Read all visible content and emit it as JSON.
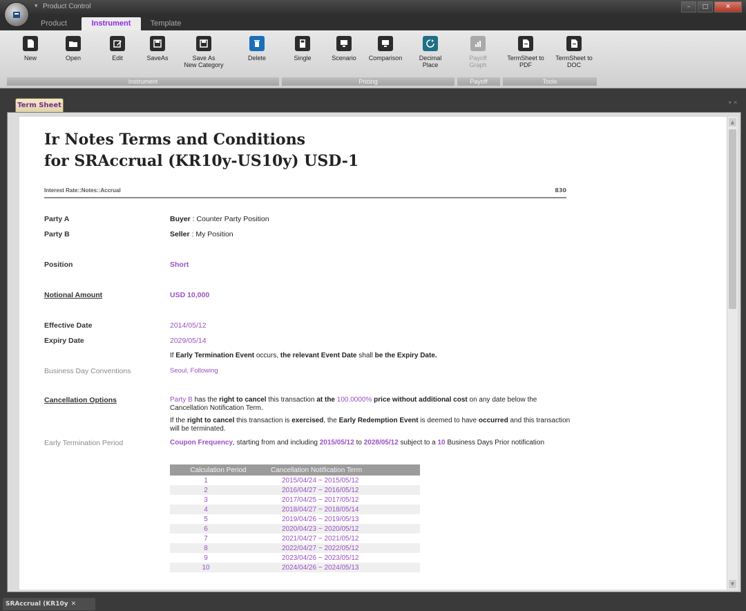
{
  "app": {
    "title": "Product Control"
  },
  "tabs": [
    "Product",
    "Instrument",
    "Template"
  ],
  "ribbon": {
    "buttons": [
      {
        "label": "New"
      },
      {
        "label": "Open"
      },
      {
        "label": "Edit"
      },
      {
        "label": "SaveAs"
      },
      {
        "label": "Save As\nNew Category"
      },
      {
        "label": "Delete"
      },
      {
        "label": "Single"
      },
      {
        "label": "Scenario"
      },
      {
        "label": "Comparison"
      },
      {
        "label": "Decimal\nPlace"
      },
      {
        "label": "Payoff\nGraph"
      },
      {
        "label": "TermSheet to\nPDF"
      },
      {
        "label": "TermSheet to\nDOC"
      }
    ],
    "groups": [
      "Instrument",
      "Pricing",
      "Payoff",
      "Tools"
    ]
  },
  "doc_tab": "Term Sheet",
  "term_sheet": {
    "title_line1": "Ir Notes Terms and Conditions",
    "title_line2": "for SRAccrual (KR10y-US10y) USD-1",
    "category": "Interest Rate::Notes::Accrual",
    "code": "830",
    "party_a_label": "Party A",
    "party_a_role": "Buyer",
    "party_a_value": " : Counter Party Position",
    "party_b_label": "Party B",
    "party_b_role": "Seller",
    "party_b_value": " : My Position",
    "position_label": "Position",
    "position_value": "Short",
    "notional_label": "Notional Amount",
    "notional_value": "USD 10,000",
    "effective_label": "Effective Date",
    "effective_value": "2014/05/12",
    "expiry_label": "Expiry Date",
    "expiry_value": "2029/05/14",
    "early_term_prefix": "If ",
    "early_term_event": "Early Termination Event",
    "early_term_mid": " occurs, ",
    "early_term_bold": "the relevant Event Date",
    "early_term_shall": " shall ",
    "early_term_end": "be the Expiry Date.",
    "bdc_label": "Business Day Conventions",
    "bdc_value": "Seoul, Following",
    "cancel_label": "Cancellation Options",
    "cancel_party": "Party B",
    "cancel_has": " has the ",
    "cancel_right": "right to cancel",
    "cancel_txn": " this transaction ",
    "cancel_at": "at the ",
    "cancel_pct": "100.0000%",
    "cancel_price": " price without additional cost",
    "cancel_rest": " on any date below the Cancellation Notification Term.",
    "exercise_if": "If the ",
    "exercise_right": "right to cancel",
    "exercise_is": " this transaction is ",
    "exercise_exercised": "exercised",
    "exercise_the": ", the ",
    "exercise_ere": "Early Redemption Event",
    "exercise_deemed": " is deemed to have ",
    "exercise_occurred": "occurred",
    "exercise_end": " and this transaction will be terminated.",
    "etp_label": "Early Termination Period",
    "etp_freq": "Coupon Frequency",
    "etp_start": ", starting from and including ",
    "etp_from": "2015/05/12",
    "etp_to_word": " to ",
    "etp_to": "2028/05/12",
    "etp_subject": " subject to a ",
    "etp_days": "10",
    "etp_end": " Business Days Prior notification",
    "table_headers": [
      "Calculation Period",
      "Cancellation Notification Term"
    ],
    "table_rows": [
      [
        "1",
        "2015/04/24 ~ 2015/05/12"
      ],
      [
        "2",
        "2016/04/27 ~ 2016/05/12"
      ],
      [
        "3",
        "2017/04/25 ~ 2017/05/12"
      ],
      [
        "4",
        "2018/04/27 ~ 2018/05/14"
      ],
      [
        "5",
        "2019/04/26 ~ 2019/05/13"
      ],
      [
        "6",
        "2020/04/23 ~ 2020/05/12"
      ],
      [
        "7",
        "2021/04/27 ~ 2021/05/12"
      ],
      [
        "8",
        "2022/04/27 ~ 2022/05/12"
      ],
      [
        "9",
        "2023/04/26 ~ 2023/05/12"
      ],
      [
        "10",
        "2024/04/26 ~ 2024/05/13"
      ]
    ]
  },
  "bottom_tab": "SRAccrual (KR10y"
}
